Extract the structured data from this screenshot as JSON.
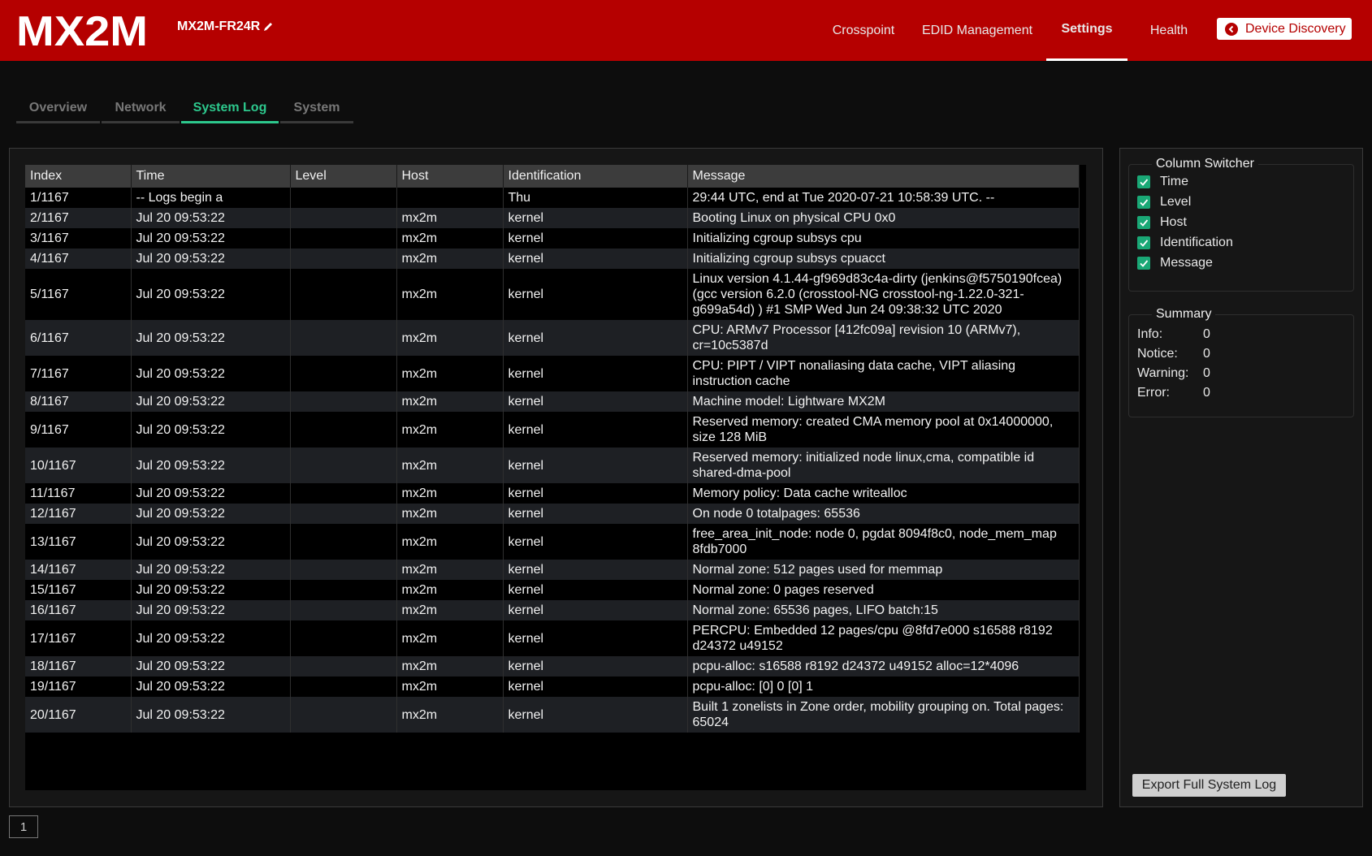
{
  "header": {
    "logo_text": "MX2M",
    "device_name": "MX2M-FR24R",
    "nav": [
      "Crosspoint",
      "EDID Management",
      "Settings",
      "Health"
    ],
    "active_nav": "Settings",
    "discovery_label": "Device Discovery"
  },
  "tabs": [
    "Overview",
    "Network",
    "System Log",
    "System"
  ],
  "active_tab": "System Log",
  "log": {
    "columns": [
      "Index",
      "Time",
      "Level",
      "Host",
      "Identification",
      "Message"
    ],
    "rows": [
      [
        "1/1167",
        "-- Logs begin a",
        "",
        "",
        "Thu",
        "29:44 UTC, end at Tue 2020-07-21 10:58:39 UTC. --"
      ],
      [
        "2/1167",
        "Jul 20 09:53:22",
        "",
        "mx2m",
        "kernel",
        "Booting Linux on physical CPU 0x0"
      ],
      [
        "3/1167",
        "Jul 20 09:53:22",
        "",
        "mx2m",
        "kernel",
        "Initializing cgroup subsys cpu"
      ],
      [
        "4/1167",
        "Jul 20 09:53:22",
        "",
        "mx2m",
        "kernel",
        "Initializing cgroup subsys cpuacct"
      ],
      [
        "5/1167",
        "Jul 20 09:53:22",
        "",
        "mx2m",
        "kernel",
        "Linux version 4.1.44-gf969d83c4a-dirty (jenkins@f5750190fcea) (gcc version 6.2.0 (crosstool-NG crosstool-ng-1.22.0-321-g699a54d) ) #1 SMP Wed Jun 24 09:38:32 UTC 2020"
      ],
      [
        "6/1167",
        "Jul 20 09:53:22",
        "",
        "mx2m",
        "kernel",
        "CPU: ARMv7 Processor [412fc09a] revision 10 (ARMv7), cr=10c5387d"
      ],
      [
        "7/1167",
        "Jul 20 09:53:22",
        "",
        "mx2m",
        "kernel",
        "CPU: PIPT / VIPT nonaliasing data cache, VIPT aliasing instruction cache"
      ],
      [
        "8/1167",
        "Jul 20 09:53:22",
        "",
        "mx2m",
        "kernel",
        "Machine model: Lightware MX2M"
      ],
      [
        "9/1167",
        "Jul 20 09:53:22",
        "",
        "mx2m",
        "kernel",
        "Reserved memory: created CMA memory pool at 0x14000000, size 128 MiB"
      ],
      [
        "10/1167",
        "Jul 20 09:53:22",
        "",
        "mx2m",
        "kernel",
        "Reserved memory: initialized node linux,cma, compatible id shared-dma-pool"
      ],
      [
        "11/1167",
        "Jul 20 09:53:22",
        "",
        "mx2m",
        "kernel",
        "Memory policy: Data cache writealloc"
      ],
      [
        "12/1167",
        "Jul 20 09:53:22",
        "",
        "mx2m",
        "kernel",
        "On node 0 totalpages: 65536"
      ],
      [
        "13/1167",
        "Jul 20 09:53:22",
        "",
        "mx2m",
        "kernel",
        "free_area_init_node: node 0, pgdat 8094f8c0, node_mem_map 8fdb7000"
      ],
      [
        "14/1167",
        "Jul 20 09:53:22",
        "",
        "mx2m",
        "kernel",
        "Normal zone: 512 pages used for memmap"
      ],
      [
        "15/1167",
        "Jul 20 09:53:22",
        "",
        "mx2m",
        "kernel",
        "Normal zone: 0 pages reserved"
      ],
      [
        "16/1167",
        "Jul 20 09:53:22",
        "",
        "mx2m",
        "kernel",
        "Normal zone: 65536 pages, LIFO batch:15"
      ],
      [
        "17/1167",
        "Jul 20 09:53:22",
        "",
        "mx2m",
        "kernel",
        "PERCPU: Embedded 12 pages/cpu @8fd7e000 s16588 r8192 d24372 u49152"
      ],
      [
        "18/1167",
        "Jul 20 09:53:22",
        "",
        "mx2m",
        "kernel",
        "pcpu-alloc: s16588 r8192 d24372 u49152 alloc=12*4096"
      ],
      [
        "19/1167",
        "Jul 20 09:53:22",
        "",
        "mx2m",
        "kernel",
        "pcpu-alloc: [0] 0 [0] 1"
      ],
      [
        "20/1167",
        "Jul 20 09:53:22",
        "",
        "mx2m",
        "kernel",
        "Built 1 zonelists in Zone order, mobility grouping on. Total pages: 65024"
      ]
    ]
  },
  "pager": {
    "current_page": "1"
  },
  "column_switcher": {
    "title": "Column Switcher",
    "items": [
      {
        "label": "Time",
        "checked": true
      },
      {
        "label": "Level",
        "checked": true
      },
      {
        "label": "Host",
        "checked": true
      },
      {
        "label": "Identification",
        "checked": true
      },
      {
        "label": "Message",
        "checked": true
      }
    ]
  },
  "summary": {
    "title": "Summary",
    "items": [
      {
        "label": "Info:",
        "value": "0"
      },
      {
        "label": "Notice:",
        "value": "0"
      },
      {
        "label": "Warning:",
        "value": "0"
      },
      {
        "label": "Error:",
        "value": "0"
      }
    ]
  },
  "export_label": "Export Full System Log",
  "colors": {
    "header_red": "#b50000",
    "accent_green": "#2dc88d",
    "checkbox_green": "#1aa876",
    "background": "#0d0d0d"
  }
}
